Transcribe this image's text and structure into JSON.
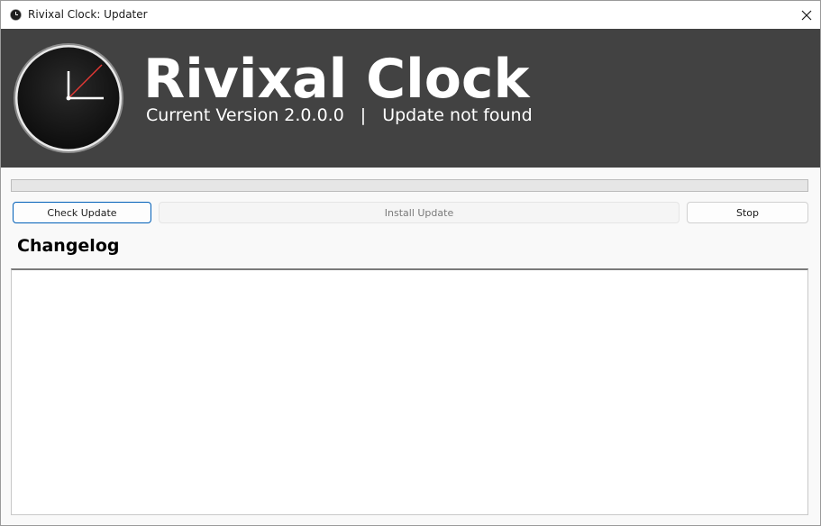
{
  "window": {
    "title": "Rivixal Clock: Updater",
    "close_icon": "close-icon"
  },
  "header": {
    "app_name": "Rivixal Clock",
    "current_version_label": "Current Version 2.0.0.0",
    "separator": "|",
    "update_status": "Update not found",
    "logo_icon": "clock-icon"
  },
  "progress": {
    "value": 0
  },
  "buttons": {
    "check_update": "Check Update",
    "install_update": "Install Update",
    "stop": "Stop"
  },
  "changelog": {
    "title": "Changelog",
    "content": ""
  },
  "colors": {
    "banner_bg": "#424242",
    "accent": "#005fb8",
    "clock_hand": "#e53935"
  }
}
